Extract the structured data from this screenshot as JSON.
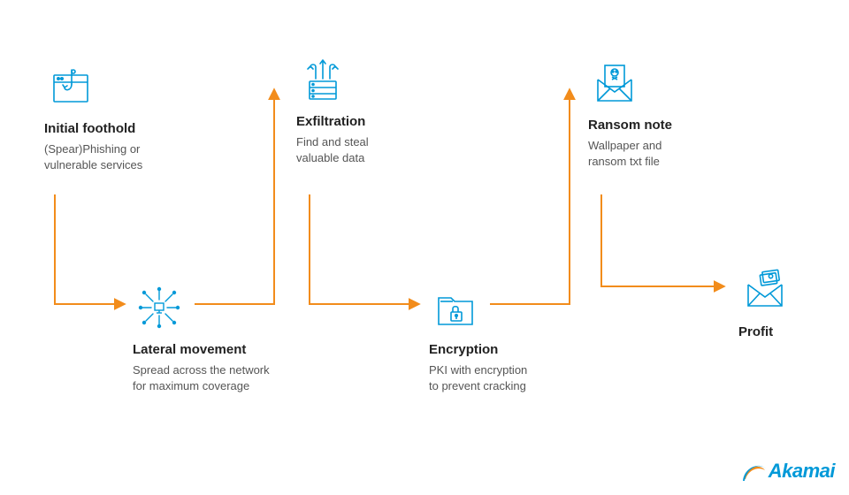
{
  "nodes": {
    "n1": {
      "title": "Initial foothold",
      "desc": "(Spear)Phishing or\nvulnerable services"
    },
    "n2": {
      "title": "Lateral movement",
      "desc": "Spread across the network\nfor maximum coverage"
    },
    "n3": {
      "title": "Exfiltration",
      "desc": "Find and steal\nvaluable data"
    },
    "n4": {
      "title": "Encryption",
      "desc": "PKI with encryption\nto prevent cracking"
    },
    "n5": {
      "title": "Ransom note",
      "desc": "Wallpaper and\nransom txt file"
    },
    "n6": {
      "title": "Profit",
      "desc": ""
    }
  },
  "colors": {
    "icon": "#0099d8",
    "arrow": "#f28c1b",
    "text_dark": "#222222",
    "text_light": "#555555"
  },
  "brand": "Akamai"
}
